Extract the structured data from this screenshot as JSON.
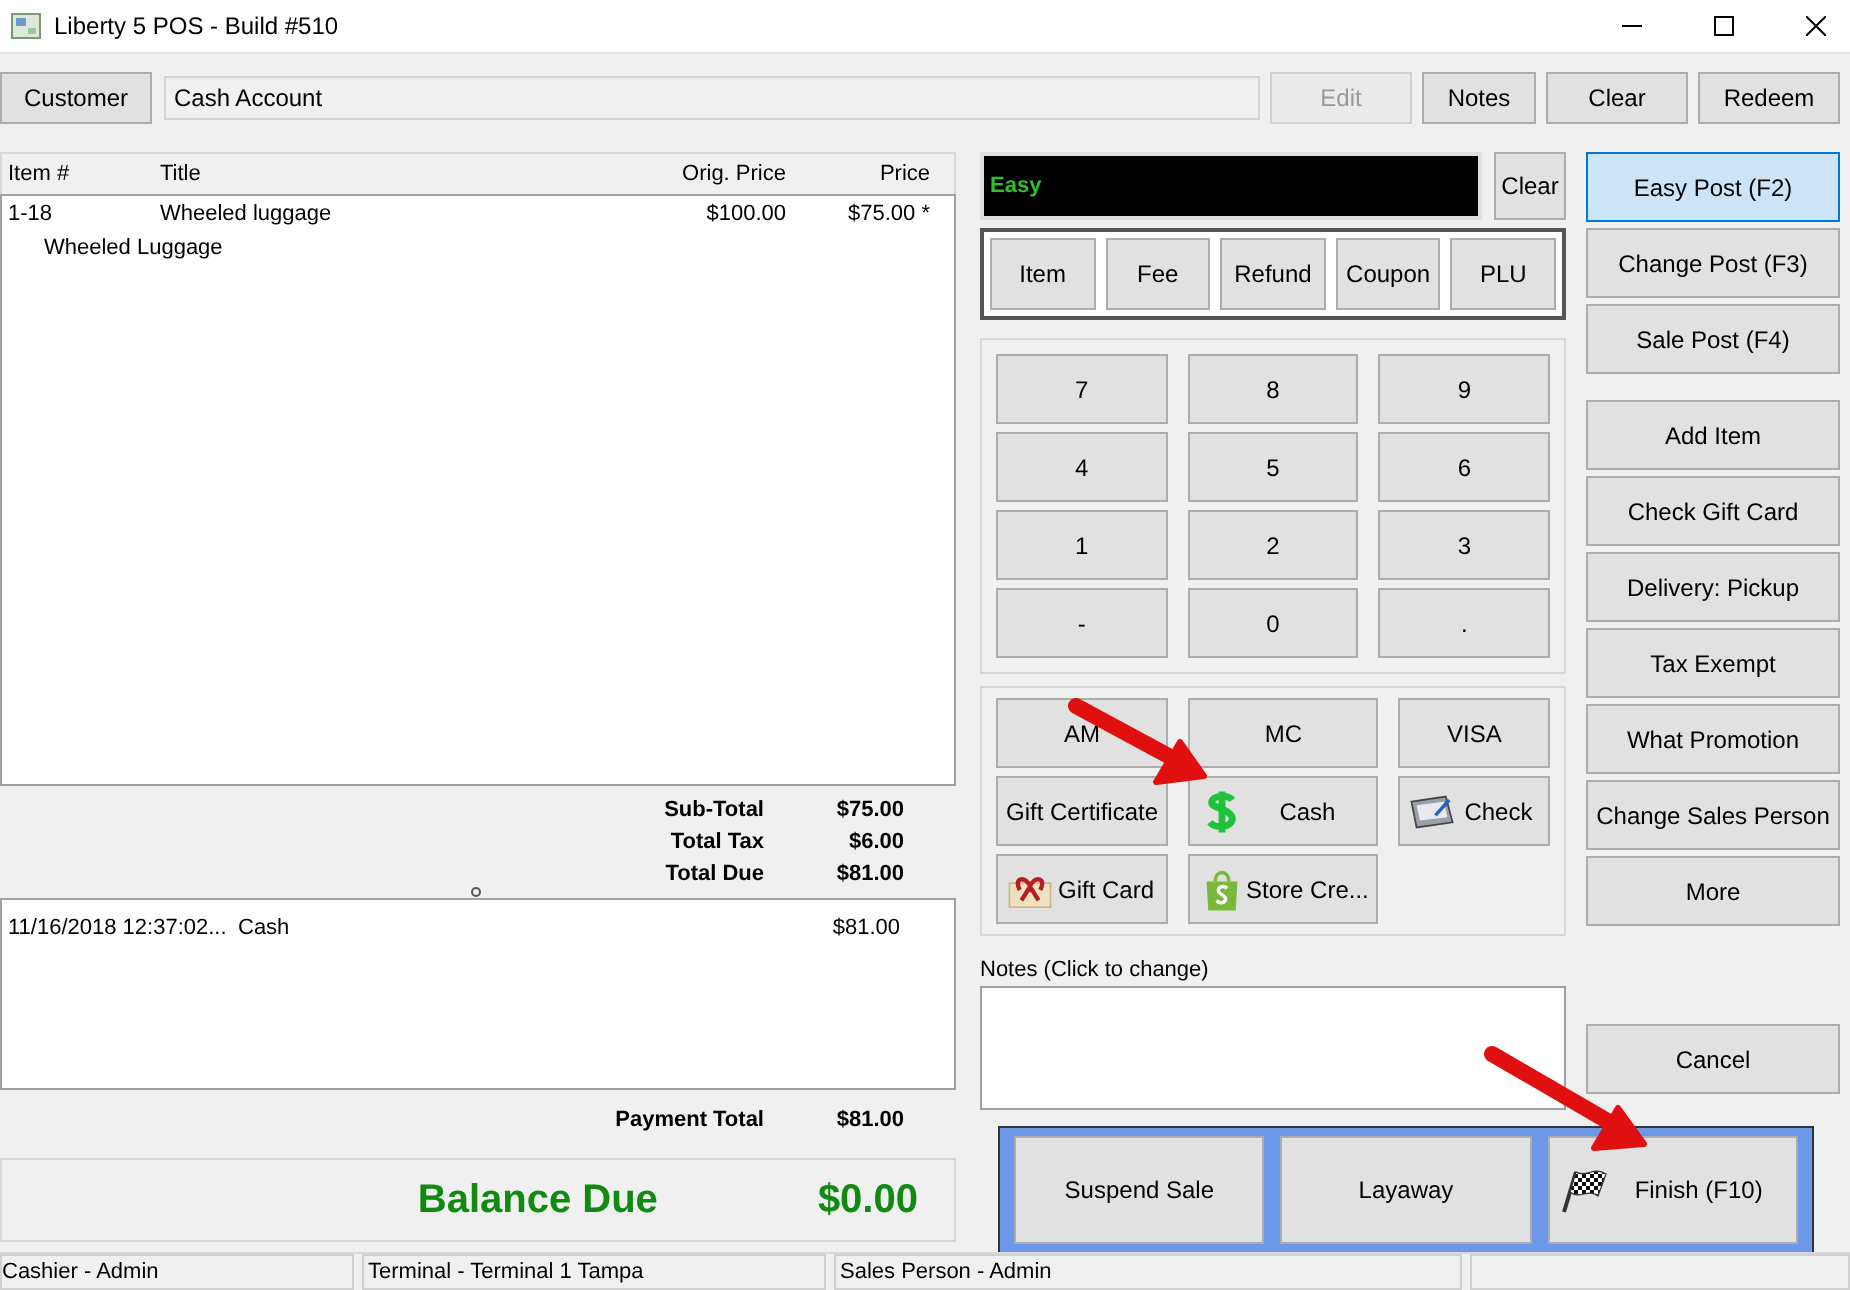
{
  "window": {
    "title": "Liberty 5 POS - Build #510"
  },
  "top_bar": {
    "customer_button": "Customer",
    "account": "Cash Account",
    "buttons": [
      {
        "label": "Edit",
        "disabled": true
      },
      {
        "label": "Notes",
        "disabled": false
      },
      {
        "label": "Clear",
        "disabled": false
      },
      {
        "label": "Redeem",
        "disabled": false
      }
    ]
  },
  "line_items": {
    "columns": [
      "Item #",
      "Title",
      "Orig. Price",
      "Price"
    ],
    "rows": [
      {
        "item": "1-18",
        "title": "Wheeled luggage",
        "orig_price": "$100.00",
        "price": "$75.00 *",
        "description": "Wheeled Luggage"
      }
    ]
  },
  "totals": [
    {
      "label": "Sub-Total",
      "value": "$75.00"
    },
    {
      "label": "Total Tax",
      "value": "$6.00"
    },
    {
      "label": "Total Due",
      "value": "$81.00"
    }
  ],
  "payments": [
    {
      "time": "11/16/2018 12:37:02...",
      "method": "Cash",
      "amount": "$81.00"
    }
  ],
  "payment_total": {
    "label": "Payment Total",
    "value": "$81.00"
  },
  "balance_due": {
    "label": "Balance Due",
    "value": "$0.00"
  },
  "entry": {
    "display": "Easy",
    "clear": "Clear"
  },
  "modes": [
    "Item",
    "Fee",
    "Refund",
    "Coupon",
    "PLU"
  ],
  "keypad": [
    "7",
    "8",
    "9",
    "4",
    "5",
    "6",
    "1",
    "2",
    "3",
    "-",
    "0",
    "."
  ],
  "tenders": [
    {
      "label": "AM",
      "kind": "plain"
    },
    {
      "label": "MC",
      "kind": "plain"
    },
    {
      "label": "VISA",
      "kind": "plain"
    },
    {
      "label": "Gift Certificate",
      "kind": "plain"
    },
    {
      "label": "Cash",
      "kind": "dollar"
    },
    {
      "label": "Check",
      "kind": "checkbook"
    },
    {
      "label": "Gift Card",
      "kind": "gift"
    },
    {
      "label": "Store Cre...",
      "kind": "bag"
    }
  ],
  "notes": {
    "label": "Notes (Click to change)"
  },
  "post_modes": [
    {
      "label": "Easy Post (F2)",
      "selected": true
    },
    {
      "label": "Change Post (F3)",
      "selected": false
    },
    {
      "label": "Sale Post (F4)",
      "selected": false
    }
  ],
  "functions": [
    "Add Item",
    "Check Gift Card",
    "Delivery: Pickup",
    "Tax Exempt",
    "What Promotion",
    "Change Sales Person",
    "More"
  ],
  "cancel": "Cancel",
  "actions": [
    {
      "label": "Suspend Sale",
      "kind": "plain"
    },
    {
      "label": "Layaway",
      "kind": "plain"
    },
    {
      "label": "Finish (F10)",
      "kind": "flag"
    }
  ],
  "status_bar": [
    "Cashier - Admin",
    "Terminal - Terminal 1 Tampa",
    "Sales Person - Admin"
  ]
}
